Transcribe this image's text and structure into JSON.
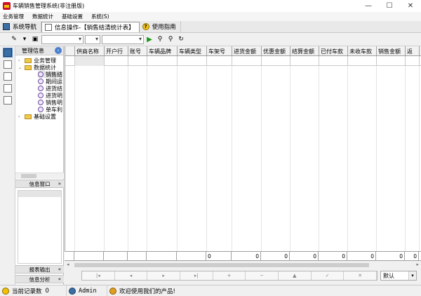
{
  "window": {
    "title": "车辆销售管理系统(非注册版)",
    "controls": [
      "—",
      "☐",
      "✕"
    ]
  },
  "menu": [
    "业务管理",
    "数据统计",
    "基础设置",
    "系统(S)"
  ],
  "tabs": [
    {
      "label": "系统导航",
      "icon": "navigation-icon"
    },
    {
      "label": "信息操作-【销售结清统计表】",
      "icon": "document-icon"
    },
    {
      "label": "使用指南",
      "icon": "help-icon"
    }
  ],
  "nav": {
    "header": "管理信息",
    "tree": [
      {
        "label": "业务管理",
        "level": 0,
        "type": "folder",
        "expanded": false
      },
      {
        "label": "数据统计",
        "level": 0,
        "type": "folder",
        "expanded": true
      },
      {
        "label": "销售结",
        "level": 1,
        "type": "leaf"
      },
      {
        "label": "期间运",
        "level": 1,
        "type": "leaf"
      },
      {
        "label": "进货结",
        "level": 1,
        "type": "leaf"
      },
      {
        "label": "进货明",
        "level": 1,
        "type": "leaf"
      },
      {
        "label": "销售明",
        "level": 1,
        "type": "leaf"
      },
      {
        "label": "单车利",
        "level": 1,
        "type": "leaf"
      },
      {
        "label": "基础设置",
        "level": 0,
        "type": "folder",
        "expanded": false
      }
    ],
    "info_panel": "信息窗口",
    "report_export": "报表输出",
    "info_analysis": "信息分析",
    "chevron_down": "»",
    "chevron_left": "«"
  },
  "grid": {
    "columns": [
      "供商名称",
      "开户行",
      "账号",
      "车辆品牌",
      "车辆类型",
      "车架号",
      "进货金额",
      "优惠金额",
      "结算金额",
      "已付车款",
      "未收车款",
      "销售金额",
      "返"
    ],
    "totals": [
      "",
      "",
      "",
      "",
      "",
      "0",
      "0",
      "0",
      "0",
      "0",
      "0",
      "0",
      "0"
    ]
  },
  "navigator": [
    "|◂",
    "◂",
    "▸",
    "▸|",
    "+",
    "−",
    "▲",
    "✓",
    "✕"
  ],
  "combo": {
    "value": "默认"
  },
  "status": {
    "record_count_label": "当前记录数",
    "record_count": "0",
    "user": "Admin",
    "message": "欢迎使用我们的产品!"
  }
}
